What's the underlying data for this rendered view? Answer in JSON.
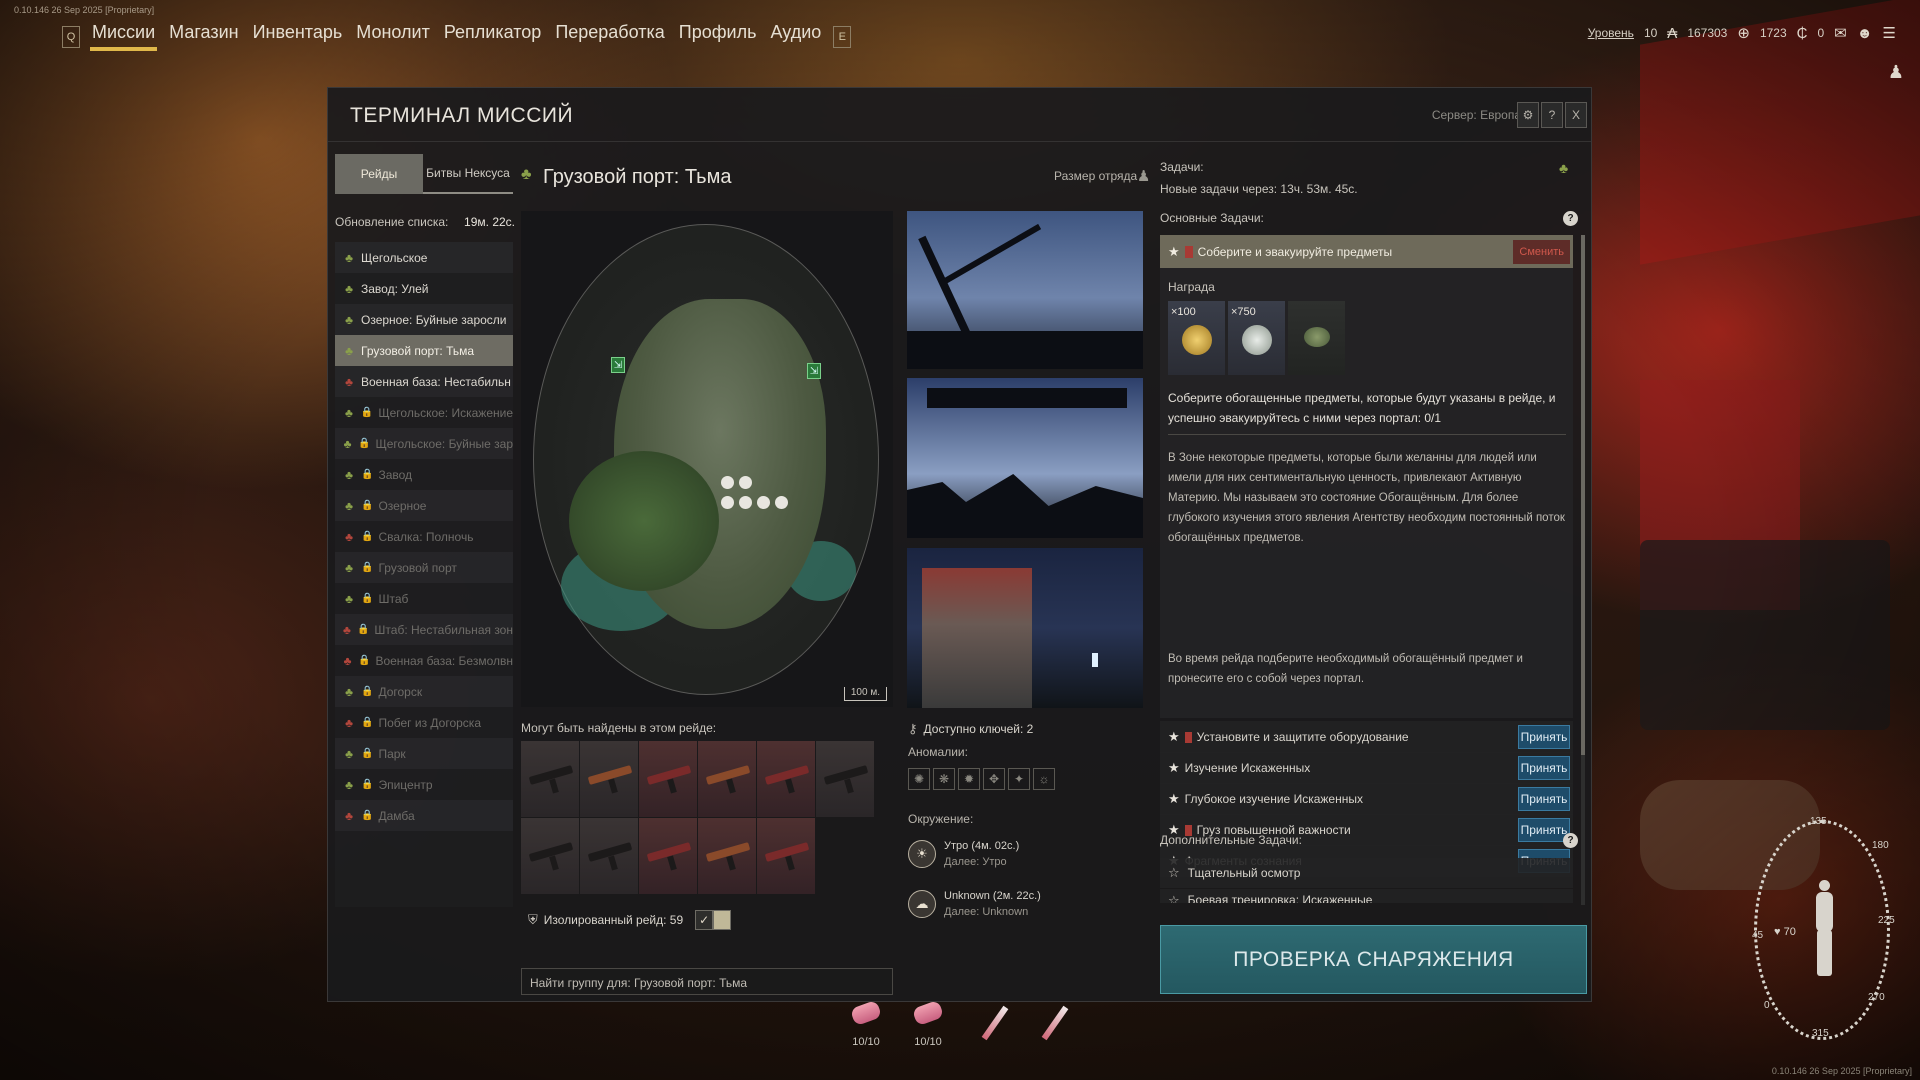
{
  "build_info": "0.10.146 26 Sep 2025 [Proprietary]",
  "nav": {
    "left_key": "Q",
    "right_key": "E",
    "items": [
      "Миссии",
      "Магазин",
      "Инвентарь",
      "Монолит",
      "Репликатор",
      "Переработка",
      "Профиль",
      "Аудио"
    ]
  },
  "status": {
    "level_label": "Уровень",
    "level": "10",
    "currency1": "167303",
    "currency2": "1723",
    "currency3": "0"
  },
  "terminal": {
    "title": "ТЕРМИНАЛ МИССИЙ",
    "server": "Сервер: Европа",
    "buttons": {
      "settings": "⚙",
      "help": "?",
      "close": "X"
    }
  },
  "tabs": {
    "raids": "Рейды",
    "nexus": "Битвы Нексуса"
  },
  "refresh": {
    "label": "Обновление списка:",
    "time": "19м. 22с."
  },
  "missions": [
    {
      "name": "Щегольское",
      "icon": "green",
      "locked": false,
      "selected": false
    },
    {
      "name": "Завод: Улей",
      "icon": "green",
      "locked": false,
      "selected": false
    },
    {
      "name": "Озерное: Буйные заросли",
      "icon": "green",
      "locked": false,
      "selected": false
    },
    {
      "name": "Грузовой порт: Тьма",
      "icon": "green",
      "locked": false,
      "selected": true
    },
    {
      "name": "Военная база: Нестабильн",
      "icon": "red",
      "locked": false,
      "selected": false
    },
    {
      "name": "Щегольское: Искажение",
      "icon": "green",
      "locked": true,
      "selected": false
    },
    {
      "name": "Щегольское: Буйные зар",
      "icon": "green",
      "locked": true,
      "selected": false
    },
    {
      "name": "Завод",
      "icon": "green",
      "locked": true,
      "selected": false
    },
    {
      "name": "Озерное",
      "icon": "green",
      "locked": true,
      "selected": false
    },
    {
      "name": "Свалка: Полночь",
      "icon": "red",
      "locked": true,
      "selected": false
    },
    {
      "name": "Грузовой порт",
      "icon": "green",
      "locked": true,
      "selected": false
    },
    {
      "name": "Штаб",
      "icon": "green",
      "locked": true,
      "selected": false
    },
    {
      "name": "Штаб: Нестабильная зон",
      "icon": "red",
      "locked": true,
      "selected": false
    },
    {
      "name": "Военная база: Безмолвн",
      "icon": "red",
      "locked": true,
      "selected": false
    },
    {
      "name": "Догорск",
      "icon": "green",
      "locked": true,
      "selected": false
    },
    {
      "name": "Побег из Догорска",
      "icon": "red",
      "locked": true,
      "selected": false
    },
    {
      "name": "Парк",
      "icon": "green",
      "locked": true,
      "selected": false
    },
    {
      "name": "Эпицентр",
      "icon": "green",
      "locked": true,
      "selected": false
    },
    {
      "name": "Дамба",
      "icon": "red",
      "locked": true,
      "selected": false
    }
  ],
  "map": {
    "title": "Грузовой порт: Тьма",
    "squad_label": "Размер отряда",
    "scale": "100 м."
  },
  "loot": {
    "label": "Могут быть найдены в этом рейде:",
    "items": [
      {
        "color": "dark",
        "rarity": "normal"
      },
      {
        "color": "orange",
        "rarity": "normal"
      },
      {
        "color": "red",
        "rarity": "rare"
      },
      {
        "color": "orange",
        "rarity": "rare"
      },
      {
        "color": "red",
        "rarity": "rare"
      },
      {
        "color": "dark",
        "rarity": "normal"
      },
      {
        "color": "dark",
        "rarity": "normal"
      },
      {
        "color": "dark",
        "rarity": "normal"
      },
      {
        "color": "red",
        "rarity": "rare"
      },
      {
        "color": "orange",
        "rarity": "rare"
      },
      {
        "color": "red",
        "rarity": "rare"
      }
    ]
  },
  "isolated": {
    "label": "Изолированный рейд: 59",
    "check": "✓"
  },
  "find_group": "Найти группу для: Грузовой порт: Тьма",
  "keys": "Доступно ключей: 2",
  "anomalies": {
    "label": "Аномалии:",
    "icons": [
      "✺",
      "❋",
      "✹",
      "✥",
      "✦",
      "☼"
    ]
  },
  "environment": {
    "label": "Окружение:",
    "entries": [
      {
        "name": "Утро",
        "time": "(4м. 02с.)",
        "next": "Далее: Утро",
        "icon": "☀"
      },
      {
        "name": "Unknown",
        "time": "(2м. 22с.)",
        "next": "Далее: Unknown",
        "icon": "☁"
      }
    ]
  },
  "tasks": {
    "label": "Задачи:",
    "new_tasks": "Новые задачи через: 13ч. 53м. 45с.",
    "main_label": "Основные Задачи:",
    "selected": {
      "name": "Соберите и эвакуируйте предметы",
      "replace": "Сменить"
    },
    "reward_label": "Награда",
    "rewards": [
      {
        "count": "×100",
        "kind": "gold"
      },
      {
        "count": "×750",
        "kind": "silver"
      },
      {
        "count": "",
        "kind": "grenade"
      }
    ],
    "description": "Соберите обогащенные предметы, которые будут указаны в рейде, и успешно эвакуируйтесь с ними через портал: 0/1",
    "lore": "В Зоне некоторые предметы, которые были желанны для людей или имели для них сентиментальную ценность, привлекают Активную Материю. Мы называем это состояние Обогащённым. Для более глубокого изучения этого явления Агентству необходим постоянный поток обогащённых предметов.",
    "lore2": "Во время рейда подберите необходимый обогащённый предмет и пронесите его с собой через портал.",
    "accept_label": "Принять",
    "others": [
      {
        "name": "Установите и защитите оборудование",
        "flag": true
      },
      {
        "name": "Изучение Искаженных",
        "flag": false
      },
      {
        "name": "Глубокое изучение Искаженных",
        "flag": false
      },
      {
        "name": "Груз повышенной важности",
        "flag": true
      },
      {
        "name": "Фрагменты сознания",
        "flag": false
      }
    ],
    "extra_label": "Дополнительные Задачи:",
    "extra": [
      {
        "name": "Тщательный осмотр"
      },
      {
        "name": "Боевая тренировка: Искаженные"
      }
    ]
  },
  "gear_check": "ПРОВЕРКА СНАРЯЖЕНИЯ",
  "hud": {
    "item1": "10/10",
    "item2": "10/10"
  },
  "compass": {
    "n1": "135",
    "n2": "180",
    "n3": "225",
    "n4": "45",
    "n5": "0",
    "n6": "315",
    "n7": "270",
    "health": "70"
  },
  "corner_info": "0.10.146 26 Sep 2025 [Proprietary]"
}
